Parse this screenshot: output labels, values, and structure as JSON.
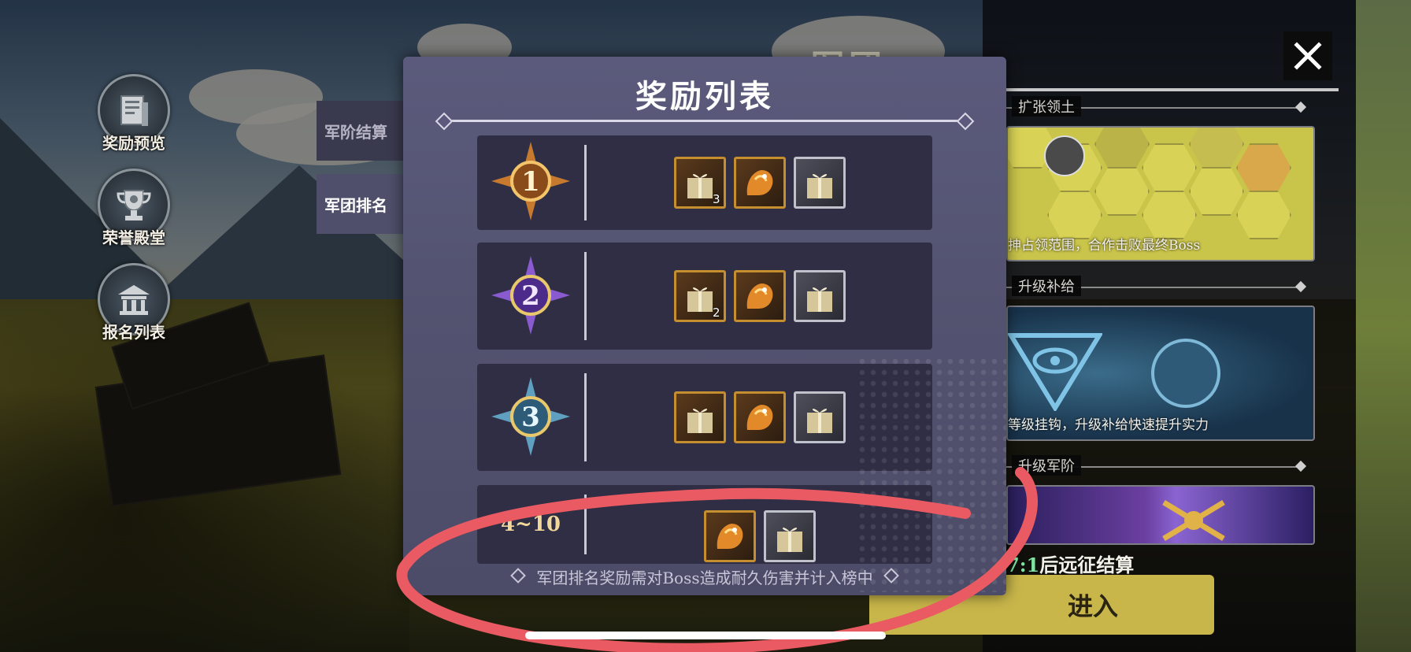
{
  "side_menu": [
    {
      "label": "奖励预览",
      "icon": "document-icon"
    },
    {
      "label": "荣誉殿堂",
      "icon": "trophy-icon"
    },
    {
      "label": "报名列表",
      "icon": "building-icon"
    }
  ],
  "tabs": {
    "rank_settlement": "军阶结算",
    "legion_ranking": "军团排名"
  },
  "modal": {
    "title": "奖励列表",
    "rows": [
      {
        "rank": "1",
        "items": [
          {
            "type": "gift",
            "count": "3",
            "frame": "gold"
          },
          {
            "type": "beast",
            "count": "",
            "frame": "gold"
          },
          {
            "type": "gift",
            "count": "",
            "frame": "silver"
          }
        ]
      },
      {
        "rank": "2",
        "items": [
          {
            "type": "gift",
            "count": "2",
            "frame": "gold"
          },
          {
            "type": "beast",
            "count": "",
            "frame": "gold"
          },
          {
            "type": "gift",
            "count": "",
            "frame": "silver"
          }
        ]
      },
      {
        "rank": "3",
        "items": [
          {
            "type": "gift",
            "count": "",
            "frame": "gold"
          },
          {
            "type": "beast",
            "count": "",
            "frame": "gold"
          },
          {
            "type": "gift",
            "count": "",
            "frame": "silver"
          }
        ]
      },
      {
        "rank": "4~10",
        "items": [
          {
            "type": "beast",
            "count": "",
            "frame": "gold"
          },
          {
            "type": "gift",
            "count": "",
            "frame": "silver"
          }
        ]
      }
    ],
    "footnote": "军团排名奖励需对Boss造成耐久伤害并计入榜中"
  },
  "right_panel": {
    "title_partial": "军团",
    "sections": [
      {
        "header": "扩张领土",
        "caption": "抻占领范围，合作击败最终Boss"
      },
      {
        "header": "升级补给",
        "caption": "等级挂钩，升级补给快速提升实力"
      },
      {
        "header": "升级军阶",
        "caption": ""
      }
    ],
    "countdown_prefix": "7:1",
    "countdown_suffix": "后远征结算",
    "enter_label": "进入"
  },
  "colors": {
    "modal_bg": "#545472",
    "row_bg": "#2f2e44",
    "gold_frame": "#c58e2e",
    "silver_frame": "#bfc2ca",
    "annotation_red": "#ea5a62"
  }
}
